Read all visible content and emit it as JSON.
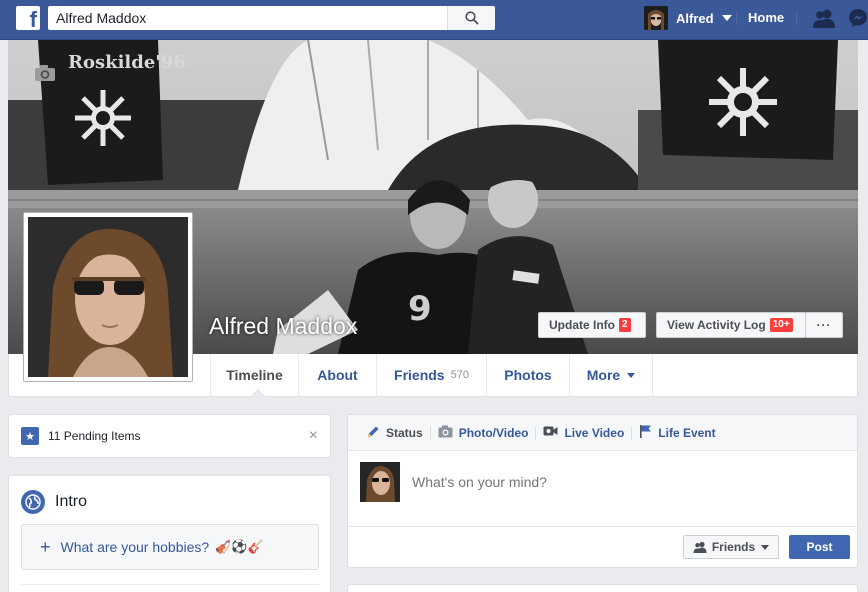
{
  "topbar": {
    "logo": "f",
    "search_value": "Alfred Maddox",
    "user_name": "Alfred",
    "home_label": "Home"
  },
  "profile": {
    "name": "Alfred Maddox",
    "cover_text": "Roskilde'96"
  },
  "cover_buttons": {
    "update_info": "Update Info",
    "update_info_badge": "2",
    "activity_log": "View Activity Log",
    "activity_log_badge": "10+",
    "more": "···"
  },
  "tabs": [
    {
      "label": "Timeline"
    },
    {
      "label": "About"
    },
    {
      "label": "Friends",
      "count": "570"
    },
    {
      "label": "Photos"
    },
    {
      "label": "More"
    }
  ],
  "pending": {
    "icon": "★",
    "label": "11 Pending Items",
    "close": "×"
  },
  "intro": {
    "title": "Intro",
    "hobbies_prompt": "What are your hobbies?",
    "hobbies_emojis": "🎻⚽🎸"
  },
  "composer": {
    "tabs": [
      {
        "label": "Status",
        "icon": "pencil-icon"
      },
      {
        "label": "Photo/Video",
        "icon": "camera-icon"
      },
      {
        "label": "Live Video",
        "icon": "video-camera-icon"
      },
      {
        "label": "Life Event",
        "icon": "flag-icon"
      }
    ],
    "placeholder": "What's on your mind?",
    "audience": "Friends",
    "post": "Post"
  },
  "colors": {
    "brand_blue": "#3b5998",
    "button_blue": "#4267b2",
    "link_blue": "#365899",
    "badge_red": "#fa3e3e",
    "page_bg": "#e9ebee"
  }
}
